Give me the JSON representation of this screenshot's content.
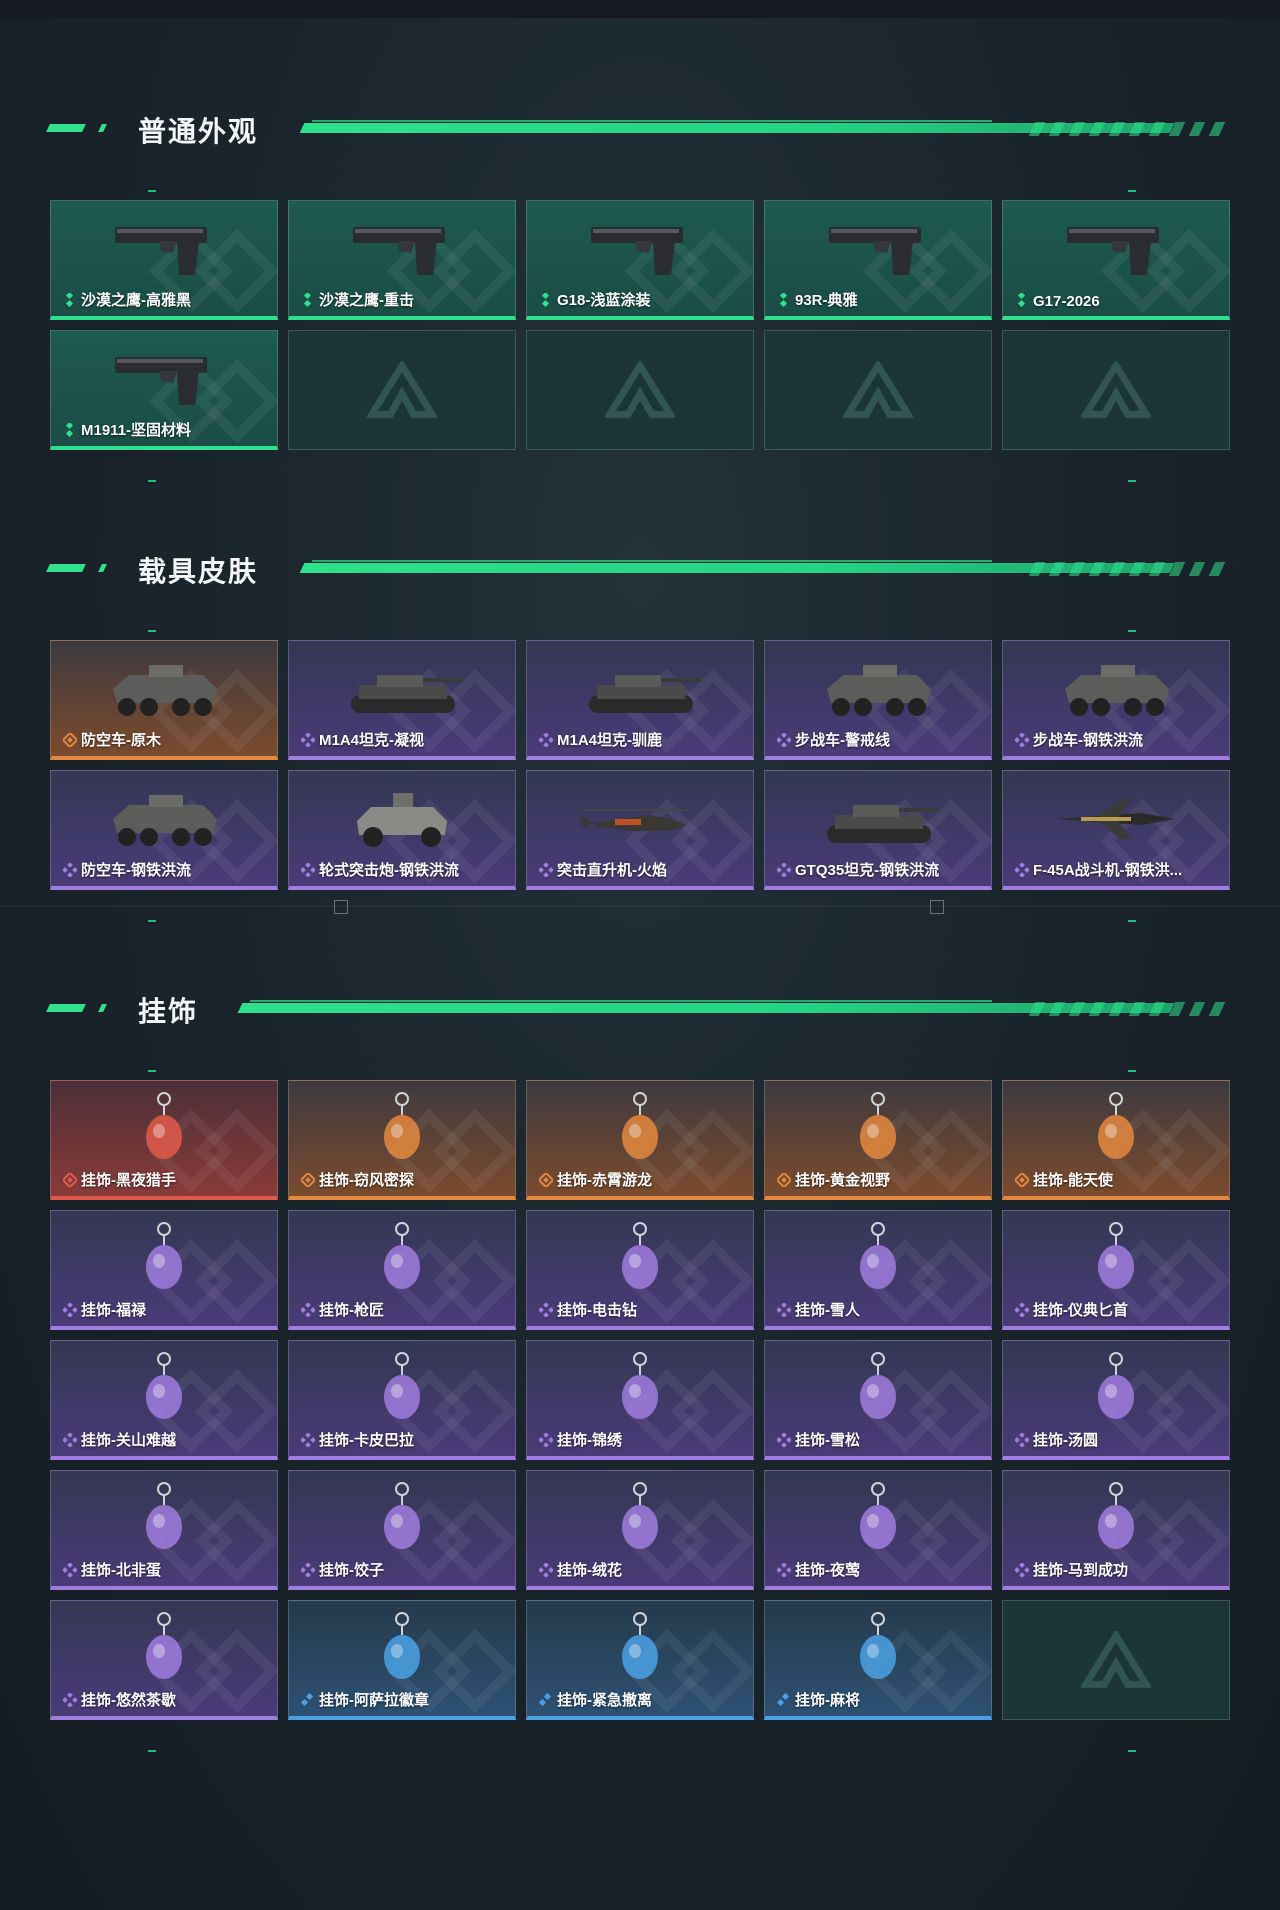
{
  "sections": [
    {
      "title": "普通外观",
      "items": [
        {
          "label": "沙漠之鹰-高雅黑",
          "rarity": "green",
          "icon": "pistol-icon"
        },
        {
          "label": "沙漠之鹰-重击",
          "rarity": "green",
          "icon": "pistol-icon"
        },
        {
          "label": "G18-浅蓝涂装",
          "rarity": "green",
          "icon": "pistol-icon"
        },
        {
          "label": "93R-典雅",
          "rarity": "green",
          "icon": "pistol-icon"
        },
        {
          "label": "G17-2026",
          "rarity": "green",
          "icon": "pistol-icon"
        },
        {
          "label": "M1911-坚固材料",
          "rarity": "green",
          "icon": "pistol-icon"
        }
      ],
      "empty_slots": 4
    },
    {
      "title": "载具皮肤",
      "items": [
        {
          "label": "防空车-原木",
          "rarity": "orange",
          "icon": "apc-icon"
        },
        {
          "label": "M1A4坦克-凝视",
          "rarity": "purple",
          "icon": "tank-icon"
        },
        {
          "label": "M1A4坦克-驯鹿",
          "rarity": "purple",
          "icon": "tank-icon"
        },
        {
          "label": "步战车-警戒线",
          "rarity": "purple",
          "icon": "apc-icon"
        },
        {
          "label": "步战车-钢铁洪流",
          "rarity": "purple",
          "icon": "apc-icon"
        },
        {
          "label": "防空车-钢铁洪流",
          "rarity": "purple",
          "icon": "apc-icon"
        },
        {
          "label": "轮式突击炮-钢铁洪流",
          "rarity": "purple",
          "icon": "armored-car-icon"
        },
        {
          "label": "突击直升机-火焰",
          "rarity": "purple",
          "icon": "helicopter-icon"
        },
        {
          "label": "GTQ35坦克-钢铁洪流",
          "rarity": "purple",
          "icon": "tank-icon"
        },
        {
          "label": "F-45A战斗机-钢铁洪...",
          "rarity": "purple",
          "icon": "jet-icon"
        }
      ],
      "empty_slots": 0
    },
    {
      "title": "挂饰",
      "items": [
        {
          "label": "挂饰-黑夜猎手",
          "rarity": "red",
          "icon": "charm-icon"
        },
        {
          "label": "挂饰-窃风密探",
          "rarity": "orange",
          "icon": "charm-icon"
        },
        {
          "label": "挂饰-赤霄游龙",
          "rarity": "orange",
          "icon": "charm-icon"
        },
        {
          "label": "挂饰-黄金视野",
          "rarity": "orange",
          "icon": "charm-icon"
        },
        {
          "label": "挂饰-能天使",
          "rarity": "orange",
          "icon": "charm-icon"
        },
        {
          "label": "挂饰-福禄",
          "rarity": "purple",
          "icon": "charm-icon"
        },
        {
          "label": "挂饰-枪匠",
          "rarity": "purple",
          "icon": "charm-icon"
        },
        {
          "label": "挂饰-电击钻",
          "rarity": "purple",
          "icon": "charm-icon"
        },
        {
          "label": "挂饰-雪人",
          "rarity": "purple",
          "icon": "charm-icon"
        },
        {
          "label": "挂饰-仪典匕首",
          "rarity": "purple",
          "icon": "charm-icon"
        },
        {
          "label": "挂饰-关山难越",
          "rarity": "purple",
          "icon": "charm-icon"
        },
        {
          "label": "挂饰-卡皮巴拉",
          "rarity": "purple",
          "icon": "charm-icon"
        },
        {
          "label": "挂饰-锦绣",
          "rarity": "purple",
          "icon": "charm-icon"
        },
        {
          "label": "挂饰-雪松",
          "rarity": "purple",
          "icon": "charm-icon"
        },
        {
          "label": "挂饰-汤圆",
          "rarity": "purple",
          "icon": "charm-icon"
        },
        {
          "label": "挂饰-北非蛋",
          "rarity": "purple",
          "icon": "charm-icon"
        },
        {
          "label": "挂饰-饺子",
          "rarity": "purple",
          "icon": "charm-icon"
        },
        {
          "label": "挂饰-绒花",
          "rarity": "purple",
          "icon": "charm-icon"
        },
        {
          "label": "挂饰-夜莺",
          "rarity": "purple",
          "icon": "charm-icon"
        },
        {
          "label": "挂饰-马到成功",
          "rarity": "purple",
          "icon": "charm-icon"
        },
        {
          "label": "挂饰-悠然茶歇",
          "rarity": "purple",
          "icon": "charm-icon"
        },
        {
          "label": "挂饰-阿萨拉徽章",
          "rarity": "blue",
          "icon": "charm-icon"
        },
        {
          "label": "挂饰-紧急撤离",
          "rarity": "blue",
          "icon": "charm-icon"
        },
        {
          "label": "挂饰-麻将",
          "rarity": "blue",
          "icon": "charm-icon"
        }
      ],
      "empty_slots": 1
    }
  ],
  "colors": {
    "accent": "#2fe08d",
    "rarity_green": "#2fe08d",
    "rarity_purple": "#a07de0",
    "rarity_orange": "#e5883d",
    "rarity_red": "#e05a4a",
    "rarity_blue": "#4aa2e6"
  }
}
